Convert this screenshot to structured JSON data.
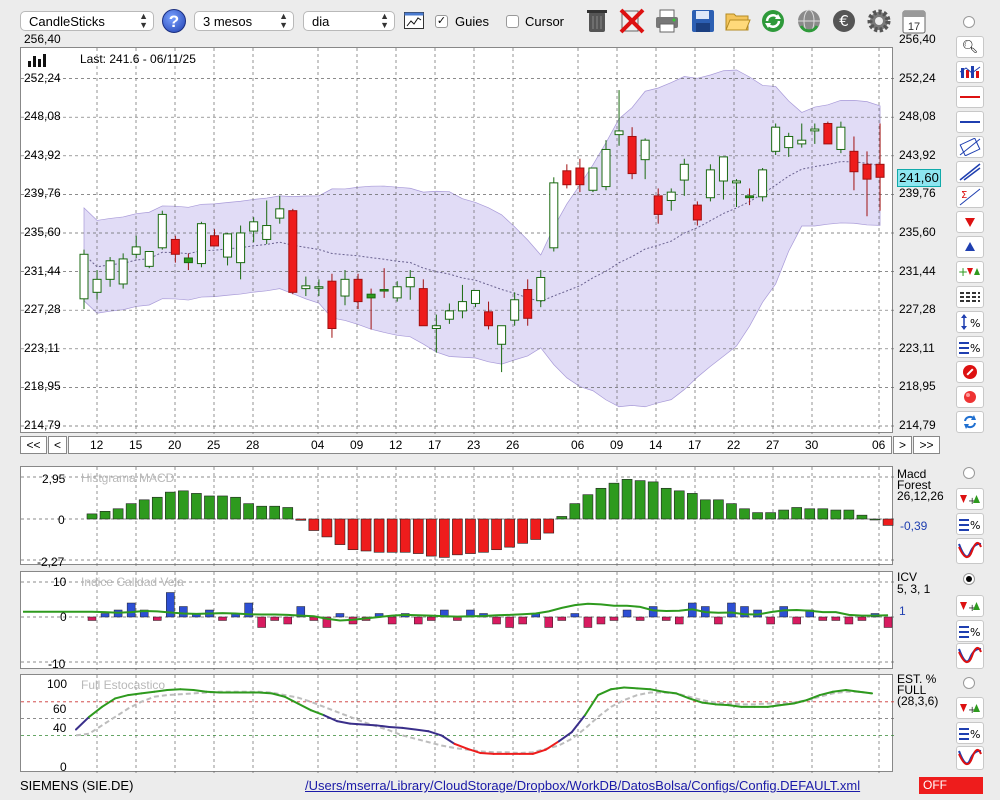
{
  "toolbar": {
    "chart_type": "CandleSticks",
    "period": "3 mesos",
    "interval": "dia",
    "guides_label": "Guies",
    "guides_checked": true,
    "cursor_label": "Cursor",
    "cursor_checked": false,
    "calendar_day": "17",
    "icons": [
      "help-icon",
      "chart-window-icon",
      "trash-icon",
      "delete-icon",
      "print-icon",
      "save-icon",
      "open-folder-icon",
      "refresh-icon",
      "globe-refresh-icon",
      "currency-icon",
      "gear-icon",
      "calendar-icon"
    ]
  },
  "main_chart": {
    "last_label": "Last: 241.6 - 06/11/25",
    "current_price": "241,60",
    "y_ticks": [
      "256,40",
      "252,24",
      "248,08",
      "243,92",
      "239,76",
      "235,60",
      "231,44",
      "227,28",
      "223,11",
      "218,95",
      "214,79"
    ],
    "x_ticks": [
      "12",
      "15",
      "20",
      "25",
      "28",
      "04",
      "09",
      "12",
      "17",
      "23",
      "26",
      "06",
      "09",
      "14",
      "17",
      "22",
      "27",
      "30",
      "06"
    ],
    "nav_buttons": [
      "<<",
      "<",
      ">",
      ">>"
    ]
  },
  "macd": {
    "title": "Histgrama MACD",
    "label_line1": "Macd",
    "label_line2": "Forest",
    "params": "26,12,26",
    "value": "-0,39",
    "y_ticks": [
      "2,95",
      "0",
      "-2,27"
    ]
  },
  "icv": {
    "title": "Indice Calidad Vela",
    "label": "ICV",
    "params": "5, 3, 1",
    "value": "1",
    "y_ticks": [
      "10",
      "0",
      "-10"
    ]
  },
  "stoch": {
    "title": "Full Estocastico",
    "label_line1": "EST. %",
    "label_line2": "FULL",
    "params": "(28,3,6)",
    "y_ticks": [
      "100",
      "60",
      "40",
      "0"
    ]
  },
  "status": {
    "symbol": "SIEMENS (SIE.DE)",
    "config_path": "/Users/mserra/Library/CloudStorage/Dropbox/WorkDB/DatosBolsa/Configs/Config.DEFAULT.xml",
    "off_label": "OFF"
  },
  "colors": {
    "up": "#2e9a1e",
    "down": "#ee1c1c",
    "band": "#c9c0ef",
    "macd_pos": "#2e9a1e",
    "macd_neg": "#ee1c1c",
    "icv_pos": "#2d4fd4",
    "icv_neg": "#d81b60",
    "stoch_k": "#2e9a1e",
    "stoch_d": "#bdbdbd",
    "stoch_low": "#ee1c1c",
    "stoch_mid": "#3a2f8a",
    "off": "#ee1c1c",
    "path_link": "#1a1aa8"
  },
  "candles": [
    {
      "o": 228.5,
      "h": 233.8,
      "l": 227.4,
      "c": 233.3
    },
    {
      "o": 229.2,
      "h": 231.6,
      "l": 228.4,
      "c": 230.6
    },
    {
      "o": 230.6,
      "h": 233.0,
      "l": 229.8,
      "c": 232.6
    },
    {
      "o": 230.1,
      "h": 233.4,
      "l": 229.6,
      "c": 232.8
    },
    {
      "o": 233.3,
      "h": 235.3,
      "l": 232.9,
      "c": 234.1
    },
    {
      "o": 232.0,
      "h": 233.4,
      "l": 231.8,
      "c": 233.6
    },
    {
      "o": 234.0,
      "h": 238.0,
      "l": 233.8,
      "c": 237.6
    },
    {
      "o": 234.9,
      "h": 235.3,
      "l": 232.4,
      "c": 233.3
    },
    {
      "o": 232.9,
      "h": 233.4,
      "l": 231.6,
      "c": 232.4
    },
    {
      "o": 232.3,
      "h": 236.8,
      "l": 231.9,
      "c": 236.6
    },
    {
      "o": 235.3,
      "h": 236.0,
      "l": 234.4,
      "c": 234.2
    },
    {
      "o": 233.0,
      "h": 235.6,
      "l": 232.1,
      "c": 235.5
    },
    {
      "o": 232.4,
      "h": 236.4,
      "l": 230.6,
      "c": 235.6
    },
    {
      "o": 235.8,
      "h": 237.3,
      "l": 234.6,
      "c": 236.8
    },
    {
      "o": 234.9,
      "h": 239.1,
      "l": 234.4,
      "c": 236.4
    },
    {
      "o": 237.2,
      "h": 239.6,
      "l": 236.6,
      "c": 238.2
    },
    {
      "o": 238.0,
      "h": 238.2,
      "l": 229.0,
      "c": 229.2
    },
    {
      "o": 229.6,
      "h": 230.9,
      "l": 228.8,
      "c": 229.9
    },
    {
      "o": 229.7,
      "h": 230.6,
      "l": 228.8,
      "c": 229.8
    },
    {
      "o": 230.4,
      "h": 231.2,
      "l": 224.3,
      "c": 225.3
    },
    {
      "o": 228.8,
      "h": 231.6,
      "l": 227.8,
      "c": 230.6
    },
    {
      "o": 230.6,
      "h": 231.2,
      "l": 227.4,
      "c": 228.2
    },
    {
      "o": 229.0,
      "h": 229.6,
      "l": 225.2,
      "c": 228.6
    },
    {
      "o": 229.5,
      "h": 231.8,
      "l": 228.6,
      "c": 229.4
    },
    {
      "o": 228.6,
      "h": 230.4,
      "l": 228.2,
      "c": 229.8
    },
    {
      "o": 229.8,
      "h": 231.6,
      "l": 228.4,
      "c": 230.8
    },
    {
      "o": 229.6,
      "h": 230.6,
      "l": 225.8,
      "c": 225.6
    },
    {
      "o": 225.3,
      "h": 226.8,
      "l": 222.7,
      "c": 225.6
    },
    {
      "o": 226.3,
      "h": 228.0,
      "l": 225.8,
      "c": 227.2
    },
    {
      "o": 227.2,
      "h": 230.0,
      "l": 226.4,
      "c": 228.2
    },
    {
      "o": 228.0,
      "h": 229.4,
      "l": 227.6,
      "c": 229.4
    },
    {
      "o": 227.1,
      "h": 228.2,
      "l": 225.2,
      "c": 225.6
    },
    {
      "o": 223.6,
      "h": 225.6,
      "l": 220.6,
      "c": 225.6
    },
    {
      "o": 226.2,
      "h": 229.2,
      "l": 225.6,
      "c": 228.4
    },
    {
      "o": 229.5,
      "h": 230.6,
      "l": 225.6,
      "c": 226.4
    },
    {
      "o": 228.3,
      "h": 231.6,
      "l": 227.6,
      "c": 230.8
    },
    {
      "o": 234.0,
      "h": 241.6,
      "l": 233.6,
      "c": 241.0
    },
    {
      "o": 242.3,
      "h": 243.0,
      "l": 240.4,
      "c": 240.8
    },
    {
      "o": 242.6,
      "h": 243.6,
      "l": 240.0,
      "c": 240.8
    },
    {
      "o": 240.2,
      "h": 242.0,
      "l": 240.0,
      "c": 242.6
    },
    {
      "o": 240.6,
      "h": 245.6,
      "l": 240.2,
      "c": 244.6
    },
    {
      "o": 246.2,
      "h": 251.0,
      "l": 245.0,
      "c": 246.6
    },
    {
      "o": 246.0,
      "h": 247.0,
      "l": 241.4,
      "c": 242.0
    },
    {
      "o": 243.5,
      "h": 245.8,
      "l": 241.4,
      "c": 245.6
    },
    {
      "o": 239.6,
      "h": 240.4,
      "l": 236.6,
      "c": 237.6
    },
    {
      "o": 239.1,
      "h": 240.4,
      "l": 238.0,
      "c": 240.0
    },
    {
      "o": 241.3,
      "h": 243.6,
      "l": 239.6,
      "c": 243.0
    },
    {
      "o": 238.6,
      "h": 239.0,
      "l": 236.4,
      "c": 237.0
    },
    {
      "o": 239.4,
      "h": 243.0,
      "l": 239.0,
      "c": 242.4
    },
    {
      "o": 241.2,
      "h": 243.8,
      "l": 239.2,
      "c": 243.8
    },
    {
      "o": 241.0,
      "h": 241.4,
      "l": 238.4,
      "c": 241.2
    },
    {
      "o": 239.6,
      "h": 240.4,
      "l": 238.6,
      "c": 239.4
    },
    {
      "o": 239.5,
      "h": 242.6,
      "l": 239.0,
      "c": 242.4
    },
    {
      "o": 244.4,
      "h": 247.4,
      "l": 244.0,
      "c": 247.0
    },
    {
      "o": 244.8,
      "h": 246.4,
      "l": 243.8,
      "c": 246.0
    },
    {
      "o": 245.2,
      "h": 247.4,
      "l": 244.8,
      "c": 245.6
    },
    {
      "o": 246.6,
      "h": 247.4,
      "l": 245.2,
      "c": 246.8
    },
    {
      "o": 247.4,
      "h": 247.6,
      "l": 245.2,
      "c": 245.2
    },
    {
      "o": 244.6,
      "h": 247.6,
      "l": 244.2,
      "c": 247.0
    },
    {
      "o": 244.4,
      "h": 246.0,
      "l": 240.2,
      "c": 242.2
    },
    {
      "o": 243.0,
      "h": 244.4,
      "l": 237.4,
      "c": 241.4
    },
    {
      "o": 243.0,
      "h": 247.4,
      "l": 238.0,
      "c": 241.6
    }
  ],
  "macd_values": [
    0.4,
    0.6,
    0.8,
    1.2,
    1.5,
    1.7,
    2.1,
    2.2,
    2.0,
    1.8,
    1.8,
    1.7,
    1.2,
    1.0,
    1.0,
    0.9,
    -0.1,
    -0.9,
    -1.4,
    -2.0,
    -2.4,
    -2.5,
    -2.6,
    -2.6,
    -2.6,
    -2.7,
    -2.9,
    -3.0,
    -2.8,
    -2.7,
    -2.6,
    -2.4,
    -2.2,
    -1.9,
    -1.6,
    -1.1,
    0.2,
    1.2,
    1.9,
    2.4,
    2.8,
    3.1,
    3.0,
    2.9,
    2.4,
    2.2,
    2.0,
    1.5,
    1.5,
    1.2,
    0.8,
    0.5,
    0.5,
    0.7,
    0.9,
    0.8,
    0.8,
    0.7,
    0.7,
    0.3,
    0.0,
    -0.5
  ],
  "icv_values": [
    -1,
    1,
    2,
    4,
    2,
    -1,
    7,
    3,
    1,
    2,
    -1,
    1,
    4,
    -3,
    -1,
    -2,
    3,
    -1,
    -3,
    1,
    -2,
    -1,
    1,
    -2,
    1,
    -2,
    -1,
    2,
    -1,
    2,
    1,
    -2,
    -3,
    -2,
    1,
    -3,
    -1,
    1,
    -3,
    -2,
    -1,
    2,
    -1,
    3,
    -1,
    -2,
    4,
    3,
    -2,
    4,
    3,
    2,
    -2,
    3,
    -2,
    2,
    -1,
    -1,
    -2,
    -1,
    1,
    -3
  ],
  "icv_line": [
    1.5,
    1.4,
    1.2,
    1.4,
    1.7,
    1.6,
    1.3,
    1.0,
    0.9,
    1.0,
    1.1,
    1.0,
    0.8,
    0.7,
    0.7,
    0.6,
    0.4,
    0.2,
    -0.5,
    -1.0,
    -0.8,
    -0.4,
    0.0,
    0.4,
    0.6,
    0.5,
    0.4,
    0.2,
    0.1,
    0.2,
    0.3,
    0.5,
    0.6,
    0.8,
    1.0,
    1.6,
    2.6,
    3.4,
    3.8,
    3.6,
    3.2,
    3.2,
    2.9,
    1.9,
    1.7,
    1.8,
    2.2,
    1.4,
    1.2,
    1.3,
    0.8,
    0.7,
    1.4,
    1.9,
    2.0,
    1.8,
    1.4,
    1.4,
    0.6,
    0.4,
    0.4,
    0.5
  ],
  "stoch_k": [
    47,
    62,
    74,
    84,
    88,
    90,
    92,
    94,
    95,
    94,
    92,
    91,
    91,
    91,
    91,
    90,
    86,
    78,
    70,
    64,
    57,
    54,
    53,
    52,
    50,
    49,
    47,
    45,
    40,
    30,
    24,
    19,
    18,
    18,
    18,
    18,
    23,
    33,
    44,
    64,
    88,
    95,
    97,
    96,
    95,
    92,
    90,
    84,
    79,
    77,
    76,
    74,
    74,
    74,
    76,
    78,
    82,
    88,
    92,
    94,
    92,
    90
  ],
  "stoch_d": [
    40,
    42,
    52,
    62,
    72,
    80,
    86,
    88,
    89,
    90,
    91,
    92,
    92,
    92,
    92,
    91,
    88,
    85,
    80,
    74,
    68,
    62,
    56,
    51,
    46,
    40,
    36,
    32,
    28,
    25,
    23,
    21,
    20,
    20,
    19,
    20,
    24,
    28,
    36,
    48,
    62,
    74,
    82,
    88,
    91,
    91,
    90,
    86,
    82,
    79,
    78,
    77,
    77,
    78,
    78,
    79,
    82,
    86,
    90,
    92,
    92,
    90
  ]
}
